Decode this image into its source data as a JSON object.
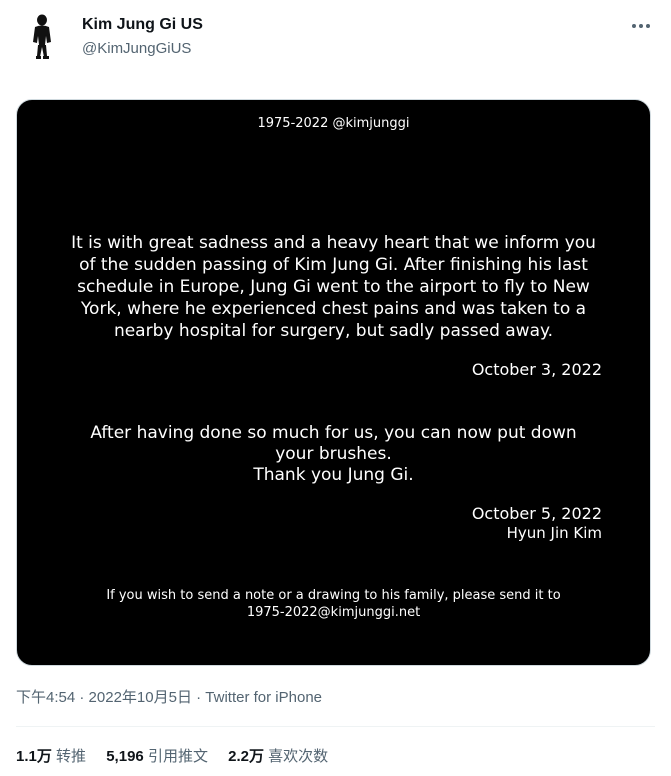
{
  "tweet": {
    "author_name": "Kim Jung Gi US",
    "author_handle": "@KimJungGiUS",
    "more_icon": "more-horizontal-icon"
  },
  "image": {
    "top_label": "1975-2022 @kimjunggi",
    "paragraph_lines": [
      "It is with great sadness and a heavy heart that we inform you",
      "of the sudden passing of Kim Jung Gi. After finishing his last",
      "schedule in Europe, Jung Gi went to the airport to fly to New",
      "York, where he experienced chest pains and was taken to a",
      "nearby hospital for surgery, but sadly passed away."
    ],
    "date1": "October 3, 2022",
    "message_lines": [
      "After having done so much for us, you can now put down",
      "your brushes.",
      "Thank you Jung Gi."
    ],
    "date2": "October 5, 2022",
    "signature": "Hyun Jin Kim",
    "footer_lines": [
      "If you wish to send a note or a drawing to his family, please send it to",
      "1975-2022@kimjunggi.net"
    ]
  },
  "meta": {
    "time": "下午4:54",
    "sep1": " · ",
    "date": "2022年10月5日",
    "sep2": " · ",
    "source": "Twitter for iPhone"
  },
  "stats": {
    "retweets_count": "1.1万",
    "retweets_label": "转推",
    "quotes_count": "5,196",
    "quotes_label": "引用推文",
    "likes_count": "2.2万",
    "likes_label": "喜欢次数"
  }
}
